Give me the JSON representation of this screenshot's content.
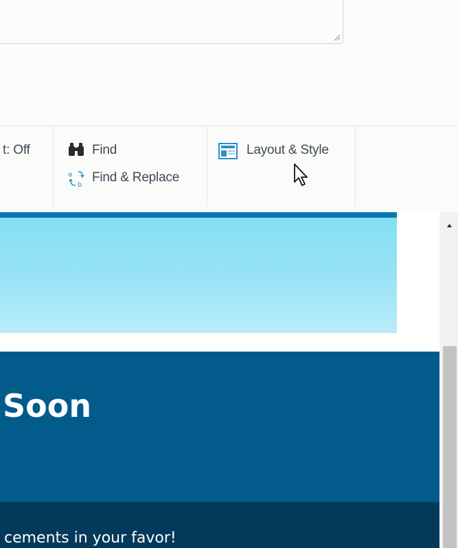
{
  "ribbon": {
    "partial_toggle_label": "t: Off",
    "find_label": "Find",
    "find_replace_label": "Find & Replace",
    "layout_style_label": "Layout & Style"
  },
  "editor": {
    "hero_title": "Soon",
    "hero_subtext": "cements in your favor!"
  },
  "colors": {
    "accent_blue": "#0a77b3",
    "hero_bg": "#025b8b",
    "dark_band": "#033a5b",
    "banner_cyan": "#84dff3"
  }
}
